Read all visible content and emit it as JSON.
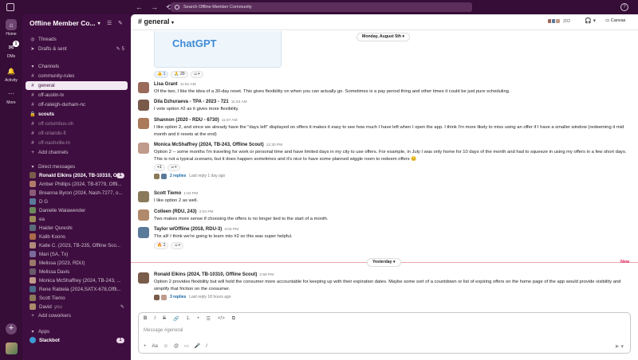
{
  "topbar": {
    "search_placeholder": "Search Offline Member Community",
    "back": "←",
    "forward": "→",
    "history": "⟲",
    "help": "?"
  },
  "rail": {
    "items": [
      {
        "label": "Home",
        "icon": "home-icon",
        "glyph": "⌂"
      },
      {
        "label": "DMs",
        "icon": "dm-icon",
        "glyph": "✉",
        "badge": "1"
      },
      {
        "label": "Activity",
        "icon": "bell-icon",
        "glyph": "🔔"
      },
      {
        "label": "More",
        "icon": "more-icon",
        "glyph": "···"
      }
    ],
    "add": "+"
  },
  "sidebar": {
    "workspace": "Offline Member Co...",
    "top": [
      {
        "label": "Threads",
        "icon": "◎"
      },
      {
        "label": "Drafts & sent",
        "icon": "➤",
        "count": "5"
      }
    ],
    "channels_header": "Channels",
    "channels": [
      {
        "label": "community-rules",
        "style": "normal"
      },
      {
        "label": "general",
        "style": "active"
      },
      {
        "label": "off-austin-tx",
        "style": "normal"
      },
      {
        "label": "off-raleigh-durham-nc",
        "style": "normal"
      },
      {
        "label": "scouts",
        "style": "bold",
        "icon": "🔒"
      },
      {
        "label": "off-columbus-oh",
        "style": "muted"
      },
      {
        "label": "off-orlando-fl",
        "style": "muted"
      },
      {
        "label": "off-nashville-tn",
        "style": "muted"
      }
    ],
    "add_channels": "Add channels",
    "dm_header": "Direct messages",
    "dms": [
      {
        "label": "Ronald Elkins (2024, TB-10310, Of...",
        "bold": true,
        "count": "1",
        "color": "#7a5c4a"
      },
      {
        "label": "Amber Phillips (2024, TB-8779, Offli...",
        "color": "#b07a68"
      },
      {
        "label": "Breanna Byron (2024, Nash-7277, o...",
        "color": "#8a5a78"
      },
      {
        "label": "D G",
        "color": "#5a7a9a"
      },
      {
        "label": "Danielle Walawender",
        "color": "#6a8a5a"
      },
      {
        "label": "ea",
        "color": "#9a8a5a"
      },
      {
        "label": "Haider Qureshi",
        "color": "#5a6a7a"
      },
      {
        "label": "Kalib Koons",
        "color": "#aa6a4a"
      },
      {
        "label": "Katie C. (2023, TB-235, Offline Sco...",
        "color": "#b08a7a"
      },
      {
        "label": "Mari (SA, Tx)",
        "color": "#7a6a9a"
      },
      {
        "label": "Melissa (2023, RDU)",
        "color": "#9a7a6a"
      },
      {
        "label": "Melissa Davis",
        "color": "#6a5a6a"
      },
      {
        "label": "Monica McShaffrey (2024, TB-243, ...",
        "color": "#c09a8a"
      },
      {
        "label": "Rene Rabiela (2024,SATX-678,Offli...",
        "color": "#4a6a8a"
      },
      {
        "label": "Scott Tiemo",
        "color": "#8a7a5a"
      },
      {
        "label": "David",
        "sub": "you",
        "color": "#aa8a6a"
      }
    ],
    "add_coworkers": "Add coworkers",
    "apps_header": "Apps",
    "apps": [
      {
        "label": "Slackbot",
        "count": "1",
        "color": "#3c9ad6"
      }
    ]
  },
  "channel": {
    "title": "# general",
    "member_count": "202",
    "canvas": "Canvas",
    "preview_text": "ChatGPT",
    "top_reactions": [
      {
        "emoji": "👍",
        "count": "1"
      },
      {
        "emoji": "🙏",
        "count": "20"
      }
    ],
    "date_divider": "Monday, August 5th",
    "yesterday_divider": "Yesterday",
    "new_label": "New"
  },
  "messages": [
    {
      "name": "Lisa Grant",
      "time": "11:51 AM",
      "color": "#9a6a5a",
      "text": "Of the two, I like the idea of a 30-day reset. This gives flexibility on when you can actually go. Sometimes is a pay period thing and other times it could be just pure scheduling."
    },
    {
      "name": "Dila Dzhuraeva - TPA - 2023 - 721",
      "time": "11:54 AM",
      "color": "#7a5a4a",
      "text": "I vote option #2 as it gives more flexibility."
    },
    {
      "name": "Shannon (2020 - RDU - 6730)",
      "time": "11:57 AM",
      "color": "#aa7a5a",
      "text": "I like option 2, and since we already have the \"days left\" displayed on offers it makes it easy to see how much I have left when I open the app. I think I'm more likely to miss using an offer if I have a smaller window (redeeming it mid month and it resets at the end)"
    },
    {
      "name": "Monica McShaffrey (2024, TB-243, Offline Scout)",
      "time": "12:30 PM",
      "color": "#c09a8a",
      "text": "Option 2 -- some months I'm traveling for work or personal time and have limited days in my city to use offers. For example, in July I was only home for 10 days of the month and had to squeeze in using my offers in a few short days. This is not a typical scenario, but it does happen sometimes and it's nice to have some planned wiggle room to redeem offers 😊",
      "reaction": "+1",
      "replies": "2 replies",
      "last_reply": "Last reply 1 day ago"
    },
    {
      "name": "Scott Tiemo",
      "time": "1:53 PM",
      "color": "#8a7a5a",
      "text": "I like option 2 as well."
    },
    {
      "name": "Colleen (RDU, 243)",
      "time": "2:04 PM",
      "color": "#b08a6a",
      "text": "Two makes more sense if choosing the offers is no longer tied to the start of a month."
    },
    {
      "name": "Taylor w/Offline (2018, RDU-3)",
      "time": "3:03 PM",
      "color": "#5a7a9a",
      "text": "Thx all! I think we're going to learn into #2 so this was super helpful.",
      "reaction": "🔥 1"
    },
    {
      "name": "Ronald Elkins (2024, TB-10310, Offline Scout)",
      "time": "2:58 PM",
      "color": "#7a5c4a",
      "text": "Option 2 provides flexibility but will hold the consumer more accountable for keeping up with their expiration dates. Maybe some sort of a countdown or list of expiring offers on the home page of the app would provide visibility and simplify that friction on the consumer.",
      "replies": "3 replies",
      "last_reply": "Last reply 18 hours ago"
    }
  ],
  "composer": {
    "placeholder": "Message #general",
    "format_buttons": [
      "B",
      "I",
      "S",
      "🔗",
      "1.",
      "•",
      "☰",
      "</>",
      "⧉"
    ],
    "tools": [
      "+",
      "Aa",
      "☺",
      "@",
      "▭",
      "🎤",
      "/"
    ],
    "send": "➤"
  }
}
